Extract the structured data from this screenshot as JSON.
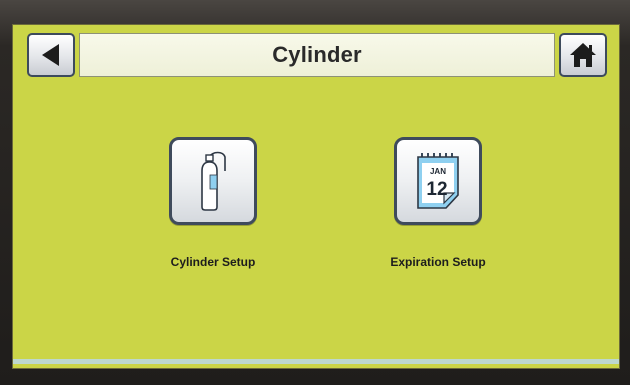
{
  "header": {
    "title": "Cylinder",
    "back_icon": "back-arrow-icon",
    "home_icon": "home-icon"
  },
  "tiles": [
    {
      "label": "Cylinder Setup",
      "icon": "gas-cylinder-icon"
    },
    {
      "label": "Expiration Setup",
      "icon": "calendar-icon",
      "icon_month": "JAN",
      "icon_day": "12"
    }
  ],
  "colors": {
    "screen_background": "#cbd547",
    "title_bar": "#eef0d8",
    "button_border": "#3f4b5c",
    "bezel": "#2b2825"
  }
}
